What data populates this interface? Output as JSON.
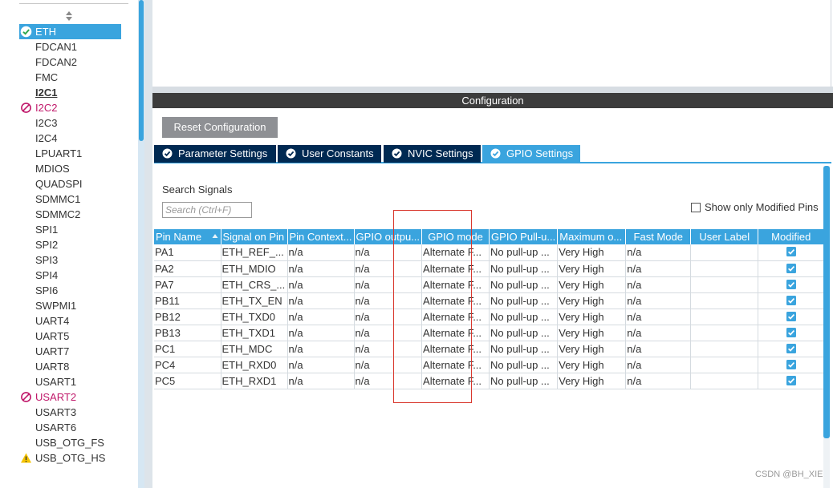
{
  "sidebar": {
    "peripherals": [
      {
        "label": "ETH",
        "status": "ok",
        "selected": true
      },
      {
        "label": "FDCAN1",
        "status": "none"
      },
      {
        "label": "FDCAN2",
        "status": "none"
      },
      {
        "label": "FMC",
        "status": "none"
      },
      {
        "label": "I2C1",
        "status": "none",
        "bold": true
      },
      {
        "label": "I2C2",
        "status": "disabled"
      },
      {
        "label": "I2C3",
        "status": "none"
      },
      {
        "label": "I2C4",
        "status": "none"
      },
      {
        "label": "LPUART1",
        "status": "none"
      },
      {
        "label": "MDIOS",
        "status": "none"
      },
      {
        "label": "QUADSPI",
        "status": "none"
      },
      {
        "label": "SDMMC1",
        "status": "none"
      },
      {
        "label": "SDMMC2",
        "status": "none"
      },
      {
        "label": "SPI1",
        "status": "none"
      },
      {
        "label": "SPI2",
        "status": "none"
      },
      {
        "label": "SPI3",
        "status": "none"
      },
      {
        "label": "SPI4",
        "status": "none"
      },
      {
        "label": "SPI6",
        "status": "none"
      },
      {
        "label": "SWPMI1",
        "status": "none"
      },
      {
        "label": "UART4",
        "status": "none"
      },
      {
        "label": "UART5",
        "status": "none"
      },
      {
        "label": "UART7",
        "status": "none"
      },
      {
        "label": "UART8",
        "status": "none"
      },
      {
        "label": "USART1",
        "status": "none"
      },
      {
        "label": "USART2",
        "status": "disabled"
      },
      {
        "label": "USART3",
        "status": "none"
      },
      {
        "label": "USART6",
        "status": "none"
      },
      {
        "label": "USB_OTG_FS",
        "status": "none"
      },
      {
        "label": "USB_OTG_HS",
        "status": "warning"
      }
    ]
  },
  "config": {
    "header": "Configuration",
    "reset_button": "Reset Configuration",
    "tabs": [
      {
        "label": "Parameter Settings",
        "active": false
      },
      {
        "label": "User Constants",
        "active": false
      },
      {
        "label": "NVIC Settings",
        "active": false
      },
      {
        "label": "GPIO Settings",
        "active": true
      }
    ],
    "search": {
      "label": "Search Signals",
      "placeholder": "Search (Ctrl+F)",
      "value": ""
    },
    "show_modified": {
      "label": "Show only Modified Pins",
      "checked": false
    },
    "table": {
      "columns": [
        "Pin Name",
        "Signal on Pin",
        "Pin Context...",
        "GPIO outpu...",
        "GPIO mode",
        "GPIO Pull-u...",
        "Maximum o...",
        "Fast Mode",
        "User Label",
        "Modified"
      ],
      "rows": [
        [
          "PA1",
          "ETH_REF_...",
          "n/a",
          "n/a",
          "Alternate F...",
          "No pull-up ...",
          "Very High",
          "n/a",
          "",
          true
        ],
        [
          "PA2",
          "ETH_MDIO",
          "n/a",
          "n/a",
          "Alternate F...",
          "No pull-up ...",
          "Very High",
          "n/a",
          "",
          true
        ],
        [
          "PA7",
          "ETH_CRS_...",
          "n/a",
          "n/a",
          "Alternate F...",
          "No pull-up ...",
          "Very High",
          "n/a",
          "",
          true
        ],
        [
          "PB11",
          "ETH_TX_EN",
          "n/a",
          "n/a",
          "Alternate F...",
          "No pull-up ...",
          "Very High",
          "n/a",
          "",
          true
        ],
        [
          "PB12",
          "ETH_TXD0",
          "n/a",
          "n/a",
          "Alternate F...",
          "No pull-up ...",
          "Very High",
          "n/a",
          "",
          true
        ],
        [
          "PB13",
          "ETH_TXD1",
          "n/a",
          "n/a",
          "Alternate F...",
          "No pull-up ...",
          "Very High",
          "n/a",
          "",
          true
        ],
        [
          "PC1",
          "ETH_MDC",
          "n/a",
          "n/a",
          "Alternate F...",
          "No pull-up ...",
          "Very High",
          "n/a",
          "",
          true
        ],
        [
          "PC4",
          "ETH_RXD0",
          "n/a",
          "n/a",
          "Alternate F...",
          "No pull-up ...",
          "Very High",
          "n/a",
          "",
          true
        ],
        [
          "PC5",
          "ETH_RXD1",
          "n/a",
          "n/a",
          "Alternate F...",
          "No pull-up ...",
          "Very High",
          "n/a",
          "",
          true
        ]
      ]
    }
  },
  "watermark": "CSDN @BH_XIE",
  "colors": {
    "accent": "#3aa4de",
    "tab_dark": "#002952",
    "header_dark": "#3c3c3c",
    "disabled": "#c0186a",
    "warning": "#f5c400",
    "highlight": "#d9372d"
  }
}
